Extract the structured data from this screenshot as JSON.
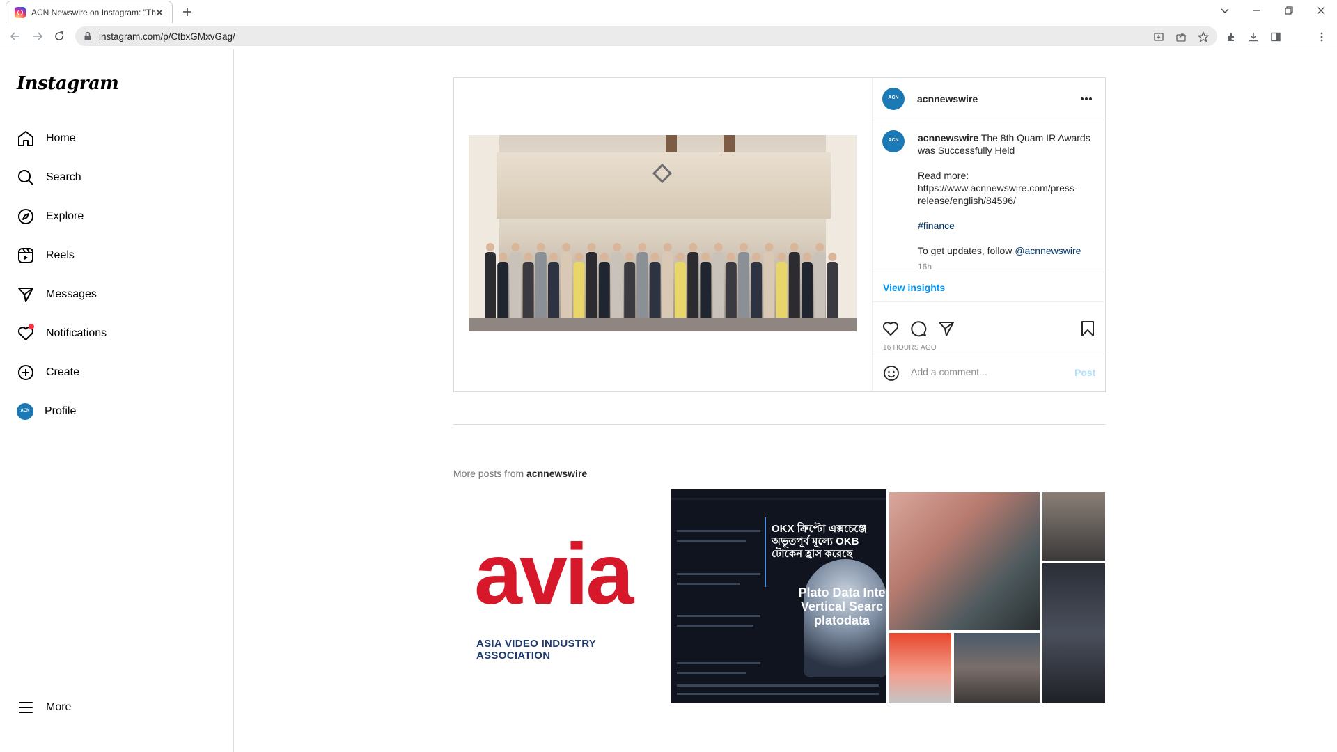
{
  "browser": {
    "tab_title": "ACN Newswire on Instagram: \"Th",
    "url": "instagram.com/p/CtbxGMxvGag/"
  },
  "sidebar": {
    "logo": "Instagram",
    "items": [
      {
        "label": "Home",
        "icon": "home-icon"
      },
      {
        "label": "Search",
        "icon": "search-icon"
      },
      {
        "label": "Explore",
        "icon": "compass-icon"
      },
      {
        "label": "Reels",
        "icon": "reels-icon"
      },
      {
        "label": "Messages",
        "icon": "messages-icon"
      },
      {
        "label": "Notifications",
        "icon": "heart-icon"
      },
      {
        "label": "Create",
        "icon": "plus-square-icon"
      },
      {
        "label": "Profile",
        "icon": "avatar"
      }
    ],
    "more_label": "More"
  },
  "post": {
    "username": "acnnewswire",
    "caption_title": "The 8th Quam IR Awards was Successfully Held",
    "read_more": "Read more:",
    "read_more_url": "https://www.acnnewswire.com/press-release/english/84596/",
    "hashtag": "#finance",
    "follow_text": "To get updates, follow",
    "follow_handle": "@acnnewswire",
    "caption_time": "16h",
    "view_insights": "View insights",
    "time_ago": "16 HOURS AGO",
    "comment_placeholder": "Add a comment...",
    "post_button": "Post"
  },
  "more_posts": {
    "prefix": "More posts from",
    "username": "acnnewswire",
    "tile1": {
      "word": "avia",
      "sub": "ASIA VIDEO INDUSTRY ASSOCIATION"
    },
    "tile2": {
      "bangla": "OKX ক্রিপ্টো এক্সচেঞ্জে অভূতপূর্ব মূল্যে OKB টোকেন হ্রাস করেছে",
      "plato": "Plato Data Inte Vertical Searc platodata"
    }
  },
  "colors": {
    "link": "#0095f6",
    "notification_dot": "#ff3040",
    "avia_red": "#d7182a"
  }
}
